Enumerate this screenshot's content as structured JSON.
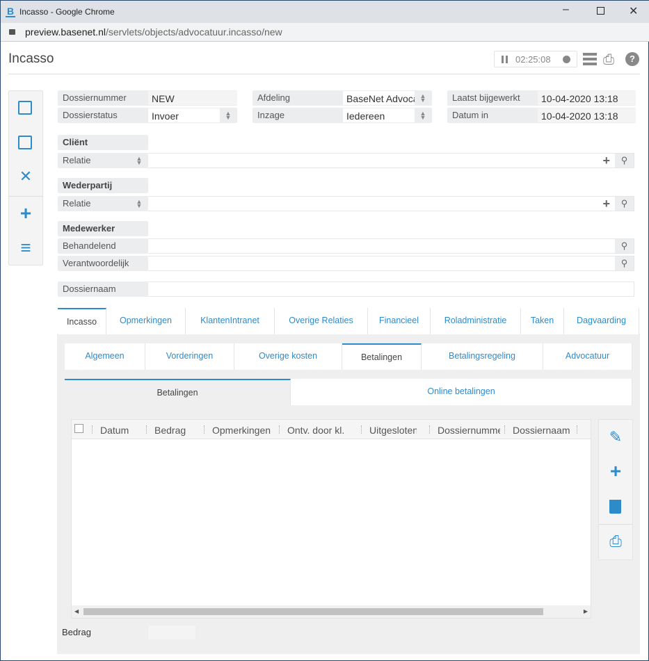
{
  "browser": {
    "title": "Incasso - Google Chrome",
    "url_host": "preview.basenet.nl",
    "url_path": "/servlets/objects/advocatuur.incasso/new"
  },
  "header": {
    "title": "Incasso",
    "timer": "02:25:08"
  },
  "form": {
    "dossiernummer": {
      "label": "Dossiernummer",
      "value": "NEW"
    },
    "dossierstatus": {
      "label": "Dossierstatus",
      "value": "Invoer"
    },
    "afdeling": {
      "label": "Afdeling",
      "value": "BaseNet Advocatuur"
    },
    "inzage": {
      "label": "Inzage",
      "value": "Iedereen"
    },
    "laatst": {
      "label": "Laatst bijgewerkt",
      "value": "10-04-2020 13:18"
    },
    "datum_in": {
      "label": "Datum in",
      "value": "10-04-2020 13:18"
    },
    "client": {
      "title": "Cliënt",
      "relatie": "Relatie"
    },
    "wederpartij": {
      "title": "Wederpartij",
      "relatie": "Relatie"
    },
    "medewerker": {
      "title": "Medewerker",
      "behandelend": "Behandelend",
      "verantwoordelijk": "Verantwoordelijk"
    },
    "dossiernaam": {
      "label": "Dossiernaam",
      "value": ""
    }
  },
  "tabs1": [
    "Incasso",
    "Opmerkingen",
    "KlantenIntranet",
    "Overige Relaties",
    "Financieel",
    "Roladministratie",
    "Taken",
    "Dagvaarding"
  ],
  "tabs2": [
    "Algemeen",
    "Vorderingen",
    "Overige kosten",
    "Betalingen",
    "Betalingsregeling",
    "Advocatuur"
  ],
  "tabs3": [
    "Betalingen",
    "Online betalingen"
  ],
  "grid": {
    "columns": [
      "Datum",
      "Bedrag",
      "Opmerkingen",
      "Ontv. door kl.",
      "Uitgesloten",
      "Dossiernummer",
      "Dossiernaam"
    ]
  },
  "footer": {
    "bedrag_label": "Bedrag",
    "bedrag_value": ""
  },
  "colors": {
    "accent": "#2e8bc9",
    "label_bg": "#ebedee"
  }
}
